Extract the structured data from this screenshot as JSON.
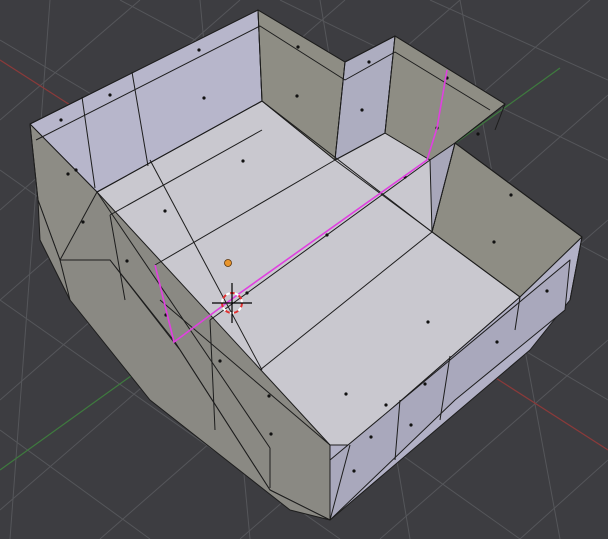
{
  "colors": {
    "background": "#3d3d41",
    "grid": "#55565a",
    "axis_x": "#8a3a3a",
    "axis_y": "#3e7a3e",
    "floor": "#c9c8cf",
    "wall_light": "#b9b8cc",
    "wall_mid": "#a9a8bb",
    "wall_dark": "#8f8e86",
    "wall_shade": "#7f7e78",
    "edge": "#1d1d1d",
    "seam": "#e040e0",
    "origin": "#e8952c",
    "cursor_red": "#e03030",
    "cursor_white": "#ffffff"
  },
  "scene": {
    "mode": "edit-mesh",
    "object": "room-mesh",
    "has_3d_cursor": true,
    "has_object_origin": true,
    "has_uv_seam": true
  }
}
